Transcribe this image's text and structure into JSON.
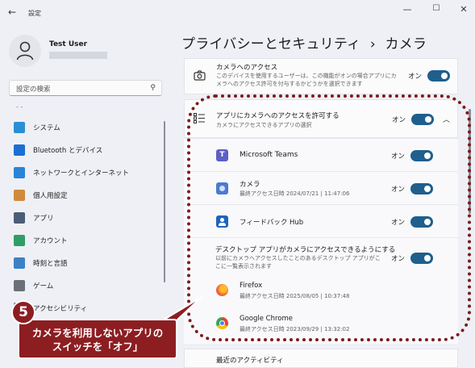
{
  "window": {
    "title": "設定",
    "back_icon": "back-arrow-icon",
    "controls": [
      "minimize-icon",
      "maximize-icon",
      "close-icon"
    ]
  },
  "profile": {
    "name": "Test User"
  },
  "search": {
    "placeholder": "設定の検索",
    "icon": "search-icon"
  },
  "sidebar": {
    "dash": "- -",
    "items": [
      {
        "label": "システム",
        "icon": "system-icon",
        "color": "#2b8fd6"
      },
      {
        "label": "Bluetooth とデバイス",
        "icon": "bluetooth-icon",
        "color": "#1b6fd1"
      },
      {
        "label": "ネットワークとインターネット",
        "icon": "wifi-icon",
        "color": "#2a84d8"
      },
      {
        "label": "個人用設定",
        "icon": "brush-icon",
        "color": "#d08a3c"
      },
      {
        "label": "アプリ",
        "icon": "apps-icon",
        "color": "#4a5e75"
      },
      {
        "label": "アカウント",
        "icon": "account-icon",
        "color": "#2f9e64"
      },
      {
        "label": "時刻と言語",
        "icon": "clock-globe-icon",
        "color": "#3b82c4"
      },
      {
        "label": "ゲーム",
        "icon": "gamepad-icon",
        "color": "#6b7078"
      },
      {
        "label": "アクセシビリティ",
        "icon": "accessibility-icon",
        "color": "#2a7bc6"
      }
    ]
  },
  "breadcrumb": {
    "parent": "プライバシーとセキュリティ",
    "separator": "›",
    "current": "カメラ"
  },
  "camera_access": {
    "title": "カメラへのアクセス",
    "description": "このデバイスを使用するユーザーは、この機能がオンの場合アプリにカメラへのアクセス許可を付与するかどうかを選択できます",
    "state": "オン",
    "icon": "camera-icon"
  },
  "app_access": {
    "title": "アプリにカメラへのアクセスを許可する",
    "description": "カメラにアクセスできるアプリの選択",
    "state": "オン",
    "icon": "app-list-icon",
    "chevron": "chevron-up-icon"
  },
  "apps": [
    {
      "name": "Microsoft Teams",
      "last_access": "",
      "state": "オン",
      "icon": "teams-icon",
      "color": "#5b5fc7"
    },
    {
      "name": "カメラ",
      "last_access": "最終アクセス日時 2024/07/21 | 11:47:06",
      "state": "オン",
      "icon": "camera-app-icon",
      "color": "#4b7bd0"
    },
    {
      "name": "フィードバック Hub",
      "last_access": "",
      "state": "オン",
      "icon": "feedback-hub-icon",
      "color": "#1d64c0"
    }
  ],
  "desktop_apps": {
    "title": "デスクトップ アプリがカメラにアクセスできるようにする",
    "description": "以前にカメラへアクセスしたことのあるデスクトップ アプリがここに一覧表示されます",
    "state": "オン",
    "items": [
      {
        "name": "Firefox",
        "last_access": "最終アクセス日時 2025/08/05 | 10:37:48",
        "icon": "firefox-icon"
      },
      {
        "name": "Google Chrome",
        "last_access": "最終アクセス日時 2023/09/29 | 13:32:02",
        "icon": "chrome-icon"
      }
    ]
  },
  "recent_activity": {
    "title": "最近のアクティビティ"
  },
  "annotation": {
    "step": "5",
    "text_line1": "カメラを利用しないアプリの",
    "text_line2": "スイッチを「オフ」",
    "color": "#8c1e22"
  }
}
